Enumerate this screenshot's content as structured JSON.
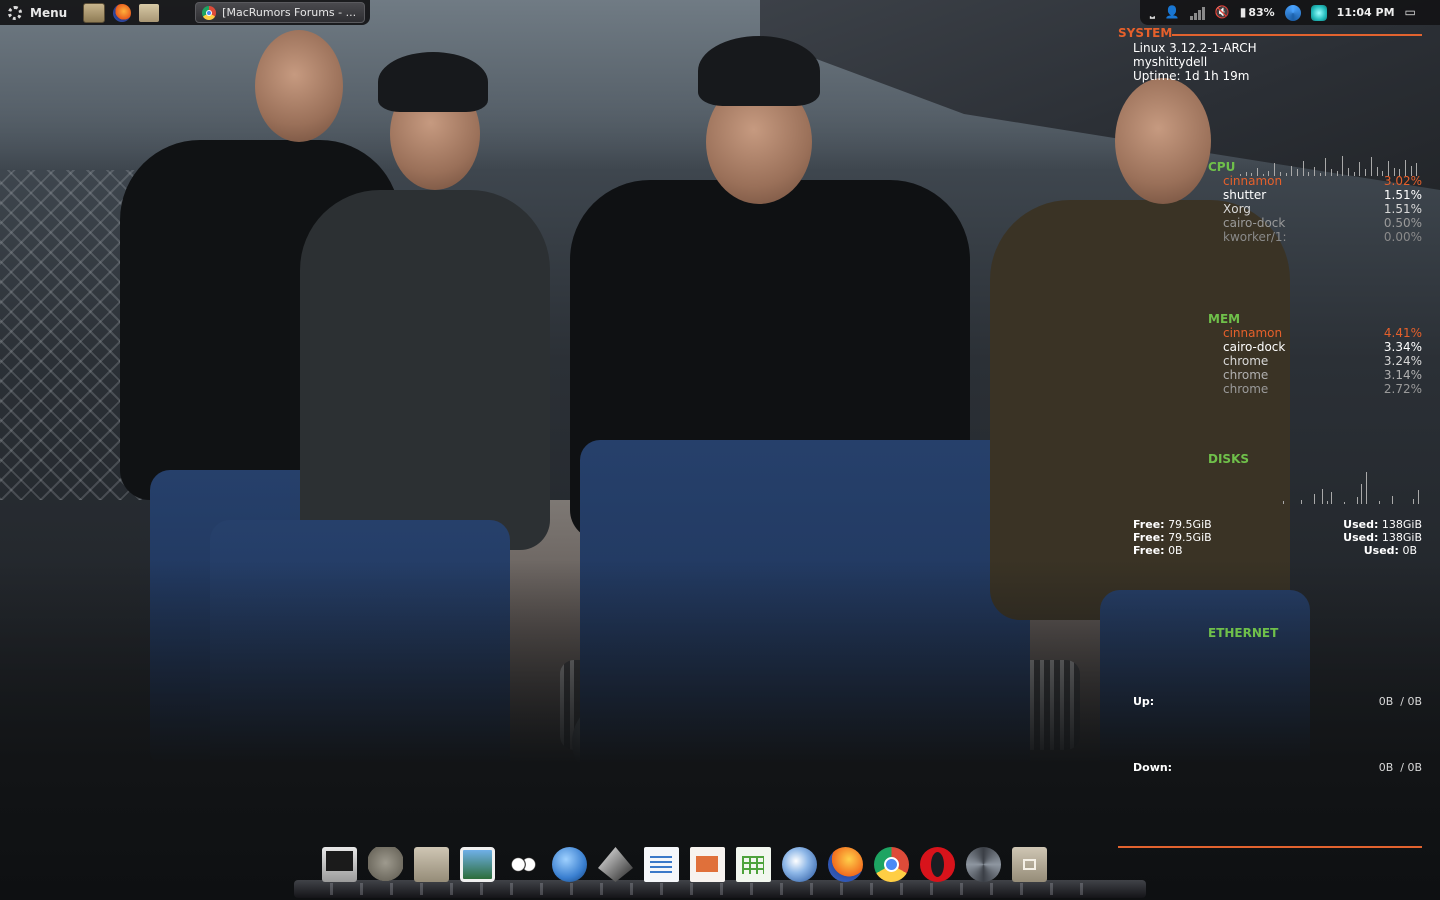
{
  "panel": {
    "menu_label": "Menu",
    "launchers": [
      "screenshot-icon",
      "firefox-icon",
      "folder-icon"
    ],
    "task_title": "[MacRumors Forums - ...",
    "tray": {
      "battery_percent": "83%",
      "clock": "11:04 PM"
    }
  },
  "conky": {
    "system": {
      "heading": "SYSTEM",
      "kernel": "Linux 3.12.2-1-ARCH",
      "hostname": "myshittydell",
      "uptime": "Uptime: 1d 1h 19m"
    },
    "cpu": {
      "heading": "CPU",
      "processes": [
        {
          "name": "cinnamon",
          "value": "3.02%"
        },
        {
          "name": "shutter",
          "value": "1.51%"
        },
        {
          "name": "Xorg",
          "value": "1.51%"
        },
        {
          "name": "cairo-dock",
          "value": "0.50%"
        },
        {
          "name": "kworker/1:",
          "value": "0.00%"
        }
      ]
    },
    "mem": {
      "heading": "MEM",
      "processes": [
        {
          "name": "cinnamon",
          "value": "4.41%"
        },
        {
          "name": "cairo-dock",
          "value": "3.34%"
        },
        {
          "name": "chrome",
          "value": "3.24%"
        },
        {
          "name": "chrome",
          "value": "3.14%"
        },
        {
          "name": "chrome",
          "value": "2.72%"
        }
      ]
    },
    "disks": {
      "heading": "DISKS",
      "free_label": "Free:",
      "used_label": "Used:",
      "rows": [
        {
          "free": "79.5GiB",
          "used": "138GiB"
        },
        {
          "free": "79.5GiB",
          "used": "138GiB"
        },
        {
          "free": "0B",
          "used": "0B"
        }
      ]
    },
    "ethernet": {
      "heading": "ETHERNET",
      "up_label": "Up:",
      "up_value": "0B  / 0B",
      "down_label": "Down:",
      "down_value": "0B  / 0B"
    },
    "colors": {
      "accent": "#e6602b",
      "section": "#6fc04a"
    }
  },
  "dock": {
    "items": [
      "monitor-icon",
      "gimp-icon",
      "file-manager-icon",
      "image-viewer-icon",
      "eyes-icon",
      "web-browser-icon",
      "inkscape-icon",
      "writer-icon",
      "impress-icon",
      "calc-icon",
      "thunderbird-icon",
      "firefox-icon",
      "chrome-icon",
      "opera-icon",
      "shutter-icon",
      "home-folder-icon"
    ]
  }
}
